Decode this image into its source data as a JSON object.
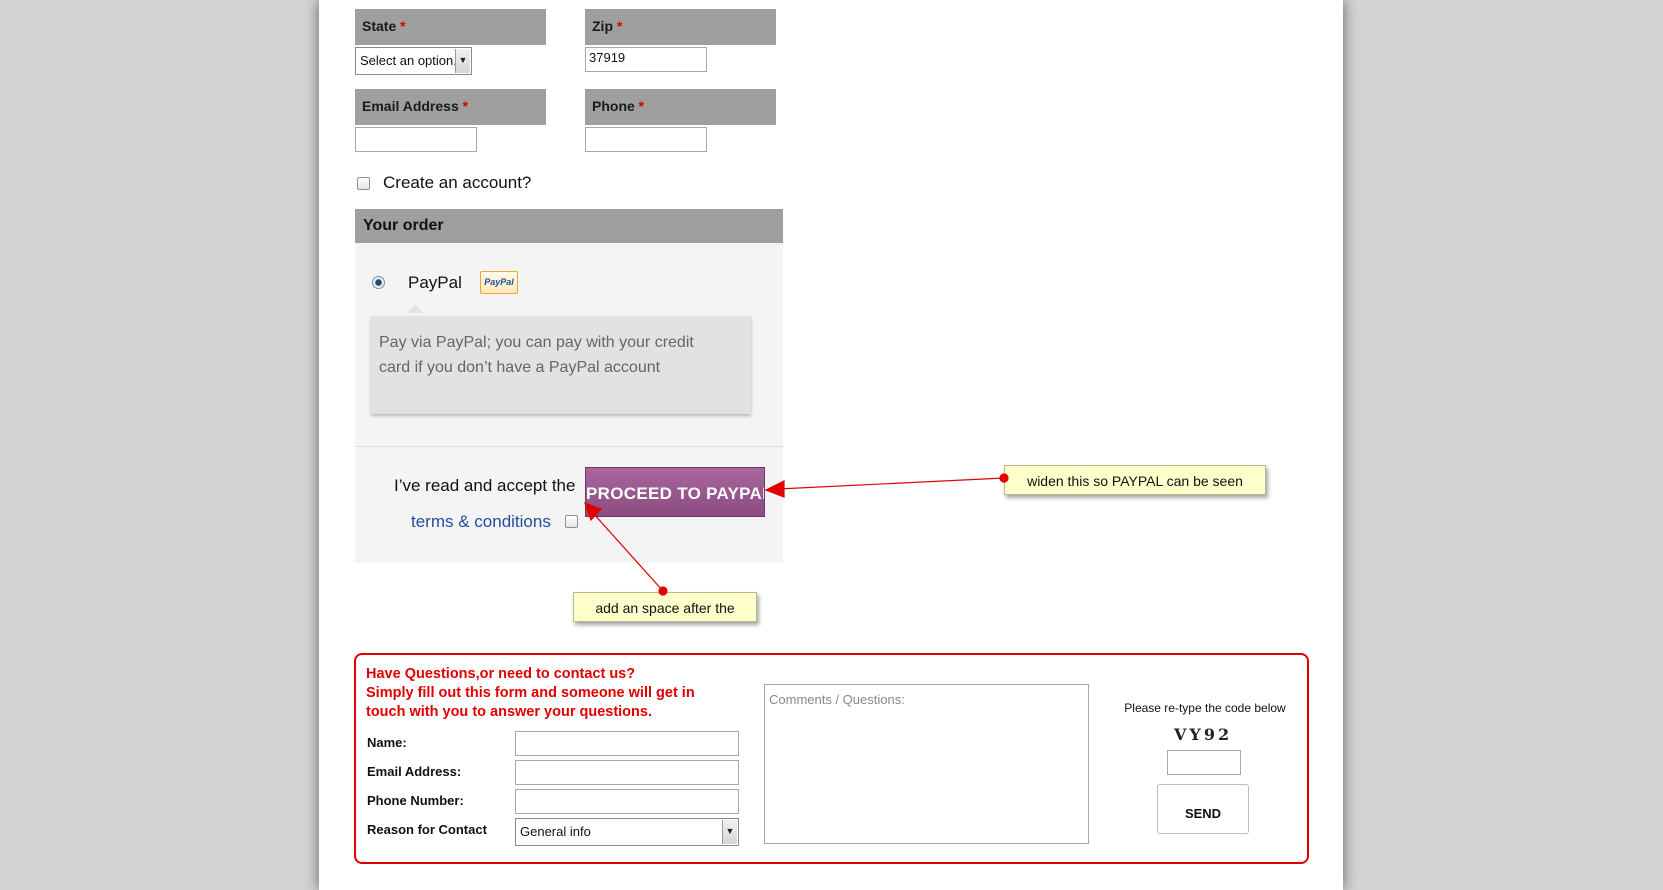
{
  "billing": {
    "state": {
      "label": "State",
      "required_mark": "*",
      "selected": "Select an option..."
    },
    "zip": {
      "label": "Zip",
      "required_mark": "*",
      "value": "37919"
    },
    "email": {
      "label": "Email Address",
      "required_mark": "*",
      "value": ""
    },
    "phone": {
      "label": "Phone",
      "required_mark": "*",
      "value": ""
    },
    "create_account": "Create an account?"
  },
  "order": {
    "heading": "Your order",
    "payment_method": "PayPal",
    "logo_text": "PayPal",
    "description_line1": "Pay via PayPal; you can pay with your credit",
    "description_line2": "card if you don’t have a PayPal account",
    "terms_prefix": "I’ve read and accept the",
    "terms_link": "terms & conditions",
    "proceed_button": "PROCEED TO PAYPAL"
  },
  "annotations": {
    "widen_note": "widen this so PAYPAL can be seen",
    "space_note": "add an space after the",
    "arrow_color": "#e00000"
  },
  "contact": {
    "heading_line1": "Have Questions,or need to contact us?",
    "heading_line2": "Simply fill out this form and someone will get in",
    "heading_line3": "touch with you to answer your questions.",
    "name_label": "Name:",
    "email_label": "Email Address:",
    "phone_label": "Phone Number:",
    "reason_label": "Reason for Contact",
    "reason_selected": "General info",
    "comments_placeholder": "Comments / Questions:",
    "captcha_label": "Please re-type the code below",
    "captcha_code": "VY92",
    "send_button": "SEND",
    "accent_color": "#e00000"
  },
  "colors": {
    "proceed_button": "#9b5a8f",
    "label_bg": "#9f9f9f",
    "link": "#214f9e"
  }
}
